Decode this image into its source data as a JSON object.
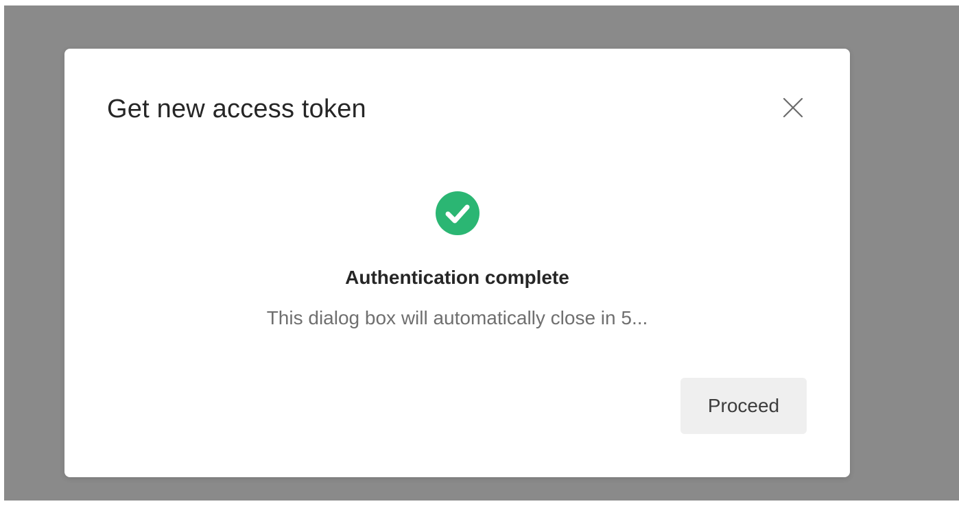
{
  "dialog": {
    "title": "Get new access token",
    "close_icon": "close-icon",
    "status": {
      "icon": "check-circle-icon",
      "icon_color": "#2bb673",
      "title": "Authentication complete",
      "message": "This dialog box will automatically close in 5..."
    },
    "proceed_label": "Proceed"
  },
  "colors": {
    "overlay": "#8a8a8a",
    "dialog_bg": "#ffffff",
    "button_bg": "#efefef",
    "success": "#2bb673"
  }
}
